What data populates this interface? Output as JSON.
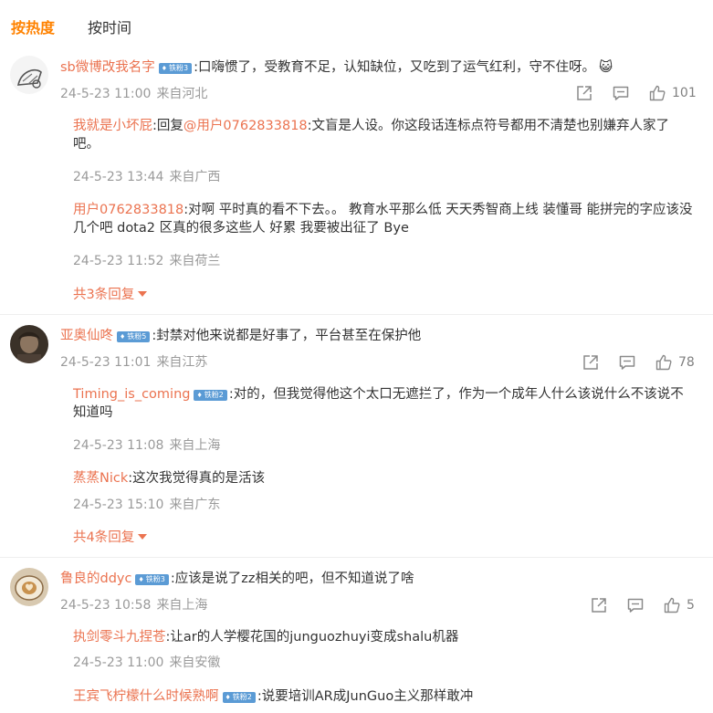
{
  "tabs": [
    "按热度",
    "按时间"
  ],
  "comments": [
    {
      "user": "sb微博改我名字",
      "badge": "铁粉3",
      "text": ":口嗨惯了，受教育不足，认知缺位，又吃到了运气红利，守不住呀。",
      "emoji": "😺",
      "time": "24-5-23 11:00",
      "location": "来自河北",
      "likes": "101",
      "replies": [
        {
          "user": "我就是小坏屁",
          "prefix": ":回复",
          "mention": "@用户0762833818",
          "text": ":文盲是人设。你这段话连标点符号都用不清楚也别嫌弃人家了吧。",
          "time": "24-5-23 13:44",
          "location": "来自广西"
        },
        {
          "user": "用户0762833818",
          "text": ":对啊 平时真的看不下去。。 教育水平那么低 天天秀智商上线 装懂哥 能拼完的字应该没几个吧 dota2 区真的很多这些人 好累 我要被出征了 Bye",
          "time": "24-5-23 11:52",
          "location": "来自荷兰"
        }
      ],
      "more": "共3条回复"
    },
    {
      "user": "亚奥仙咚",
      "badge": "铁粉5",
      "text": ":封禁对他来说都是好事了，平台甚至在保护他",
      "time": "24-5-23 11:01",
      "location": "来自江苏",
      "likes": "78",
      "replies": [
        {
          "user": "Timing_is_coming",
          "badge": "铁粉2",
          "text": ":对的，但我觉得他这个太口无遮拦了，作为一个成年人什么该说什么不该说不知道吗",
          "time": "24-5-23 11:08",
          "location": "来自上海"
        },
        {
          "user": "蒸蒸Nick",
          "text": ":这次我觉得真的是活该",
          "time": "24-5-23 15:10",
          "location": "来自广东"
        }
      ],
      "more": "共4条回复"
    },
    {
      "user": "鲁良的ddyc",
      "badge": "铁粉3",
      "text": ":应该是说了zz相关的吧，但不知道说了啥",
      "time": "24-5-23 10:58",
      "location": "来自上海",
      "likes": "5",
      "replies": [
        {
          "user": "执剑零斗九捏苍",
          "text": ":让ar的人学樱花国的junguozhuyi变成shalu机器",
          "time": "24-5-23 11:00",
          "location": "来自安徽"
        },
        {
          "user": "王宾飞柠檬什么时候熟啊",
          "badge": "铁粉2",
          "text": ":说要培训AR成JunGuo主义那样敢冲"
        }
      ]
    }
  ],
  "colors": {
    "accent": "#ff8200",
    "username": "#eb7350",
    "meta": "#9a9a9a",
    "badge": "#5b9bd5"
  },
  "icons": {
    "share": "share-icon",
    "comment": "comment-icon",
    "like": "like-icon",
    "dropdown": "caret-down-icon"
  }
}
